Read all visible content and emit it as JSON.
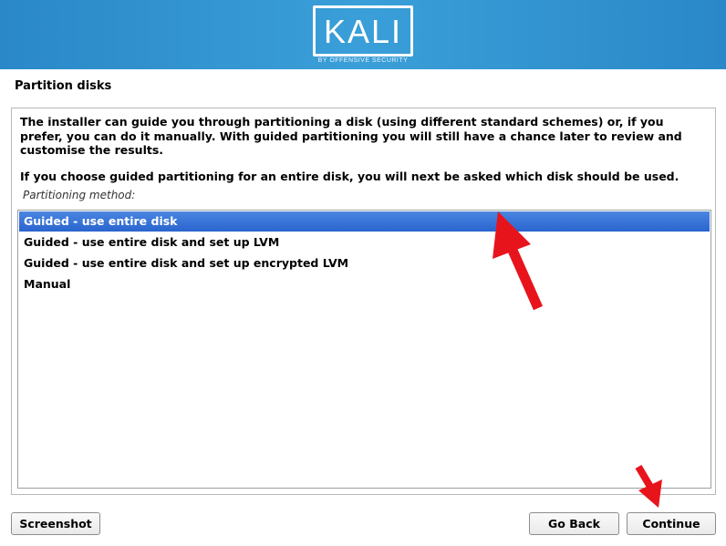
{
  "header": {
    "logo_text": "KALI",
    "logo_subtitle": "BY OFFENSIVE SECURITY",
    "background_color": "#2a88c8"
  },
  "page": {
    "title": "Partition disks",
    "description": "The installer can guide you through partitioning a disk (using different standard schemes) or, if you prefer, you can do it manually. With guided partitioning you will still have a chance later to review and customise the results.",
    "description2": "If you choose guided partitioning for an entire disk, you will next be asked which disk should be used.",
    "method_label": "Partitioning method:"
  },
  "options": [
    {
      "label": "Guided - use entire disk",
      "selected": true
    },
    {
      "label": "Guided - use entire disk and set up LVM",
      "selected": false
    },
    {
      "label": "Guided - use entire disk and set up encrypted LVM",
      "selected": false
    },
    {
      "label": "Manual",
      "selected": false
    }
  ],
  "buttons": {
    "screenshot": "Screenshot",
    "go_back": "Go Back",
    "continue": "Continue"
  },
  "colors": {
    "selection": "#2a64cf",
    "annotation_arrow": "#e8141c"
  }
}
